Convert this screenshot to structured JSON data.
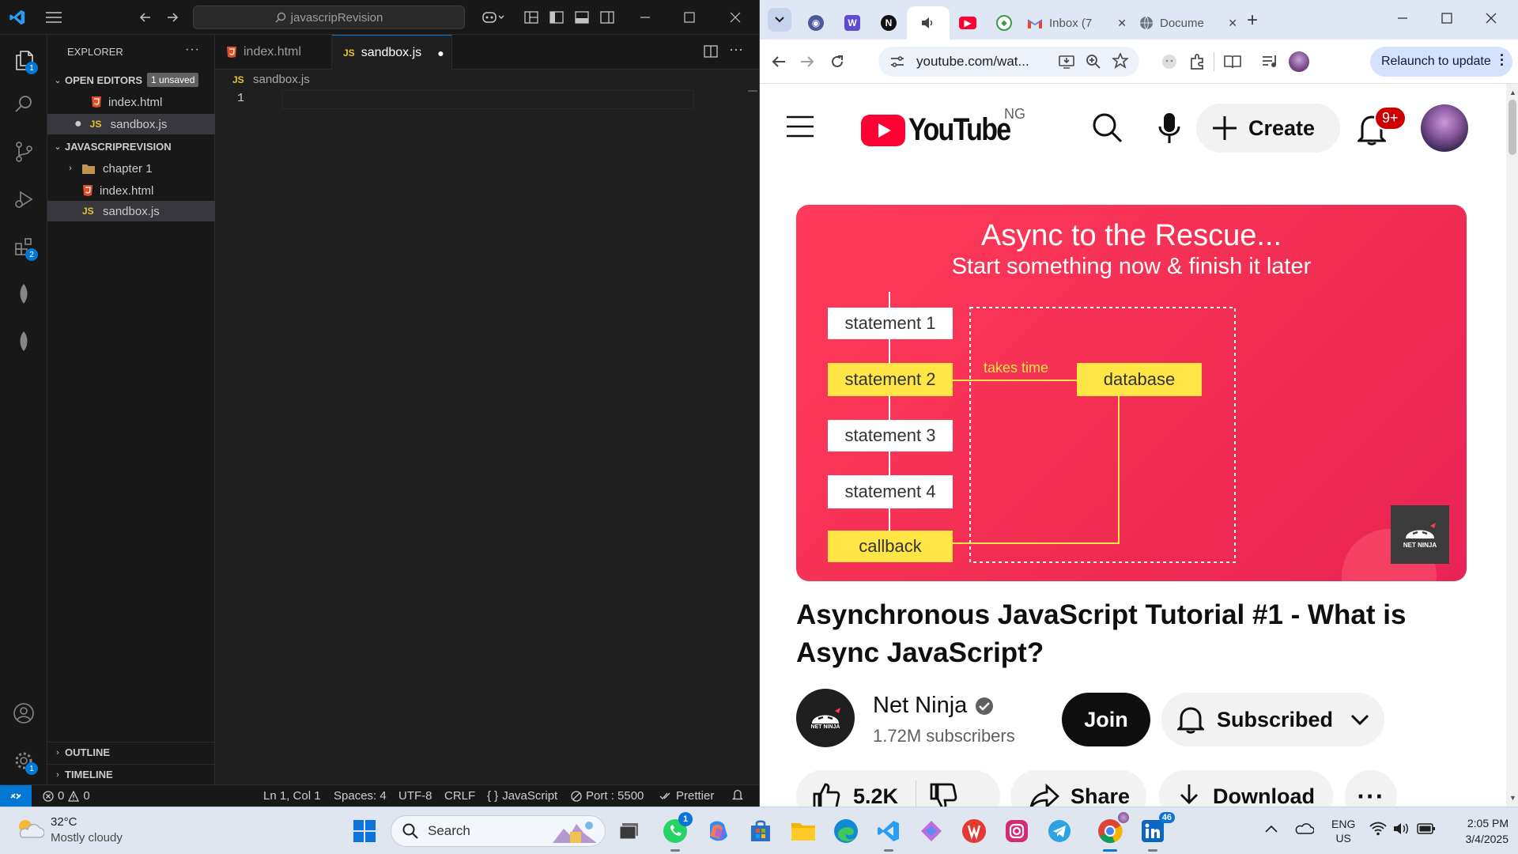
{
  "vscode": {
    "title_search": "javascripRevision",
    "explorer_title": "EXPLORER",
    "open_editors_label": "OPEN EDITORS",
    "unsaved_badge": "1 unsaved",
    "open_editors": [
      {
        "name": "index.html",
        "type": "html"
      },
      {
        "name": "sandbox.js",
        "type": "js"
      }
    ],
    "project_label": "JAVASCRIPREVISION",
    "tree": [
      {
        "name": "chapter 1",
        "type": "folder"
      },
      {
        "name": "index.html",
        "type": "html"
      },
      {
        "name": "sandbox.js",
        "type": "js"
      }
    ],
    "outline_label": "OUTLINE",
    "timeline_label": "TIMELINE",
    "tabs": [
      {
        "name": "index.html",
        "type": "html"
      },
      {
        "name": "sandbox.js",
        "type": "js"
      }
    ],
    "breadcrumb": "sandbox.js",
    "line_number": "1",
    "activity_badges": {
      "explorer": "1",
      "extensions": "2",
      "settings": "1"
    },
    "js_tag": "JS",
    "status": {
      "errors": "0",
      "warnings": "0",
      "position": "Ln 1, Col 1",
      "spaces": "Spaces: 4",
      "encoding": "UTF-8",
      "eol": "CRLF",
      "language": "JavaScript",
      "port": "Port : 5500",
      "prettier": "Prettier"
    }
  },
  "chrome": {
    "tabs": [
      {
        "label": "",
        "icon": "copilot-icon"
      },
      {
        "label": "",
        "icon": "w-icon"
      },
      {
        "label": "",
        "icon": "notion-icon"
      },
      {
        "label": "",
        "icon": "speaker-icon"
      },
      {
        "label": "",
        "icon": "youtube-icon"
      },
      {
        "label": "",
        "icon": "green-icon"
      },
      {
        "label": "Inbox (7",
        "icon": "gmail-icon"
      },
      {
        "label": "Docume",
        "icon": "globe-icon"
      }
    ],
    "url": "youtube.com/wat...",
    "relaunch_label": "Relaunch to update"
  },
  "youtube": {
    "logo_text": "YouTube",
    "country": "NG",
    "create_label": "Create",
    "notif_badge": "9+",
    "thumb": {
      "title": "Async to the Rescue...",
      "subtitle": "Start something now & finish it later",
      "statements": [
        "statement 1",
        "statement 2",
        "statement 3",
        "statement 4",
        "callback"
      ],
      "takes_time": "takes time",
      "database": "database",
      "brand": "NET NINJA"
    },
    "video_title": "Asynchronous JavaScript Tutorial #1 - What is Async JavaScript?",
    "channel_name": "Net Ninja",
    "subscribers": "1.72M subscribers",
    "join_label": "Join",
    "subscribed_label": "Subscribed",
    "likes": "5.2K",
    "share_label": "Share",
    "download_label": "Download"
  },
  "taskbar": {
    "temperature": "32°C",
    "weather": "Mostly cloudy",
    "search_label": "Search",
    "whatsapp_badge": "1",
    "linkedin_badge": "46",
    "lang_top": "ENG",
    "lang_bottom": "US",
    "time": "2:05 PM",
    "date": "3/4/2025"
  }
}
